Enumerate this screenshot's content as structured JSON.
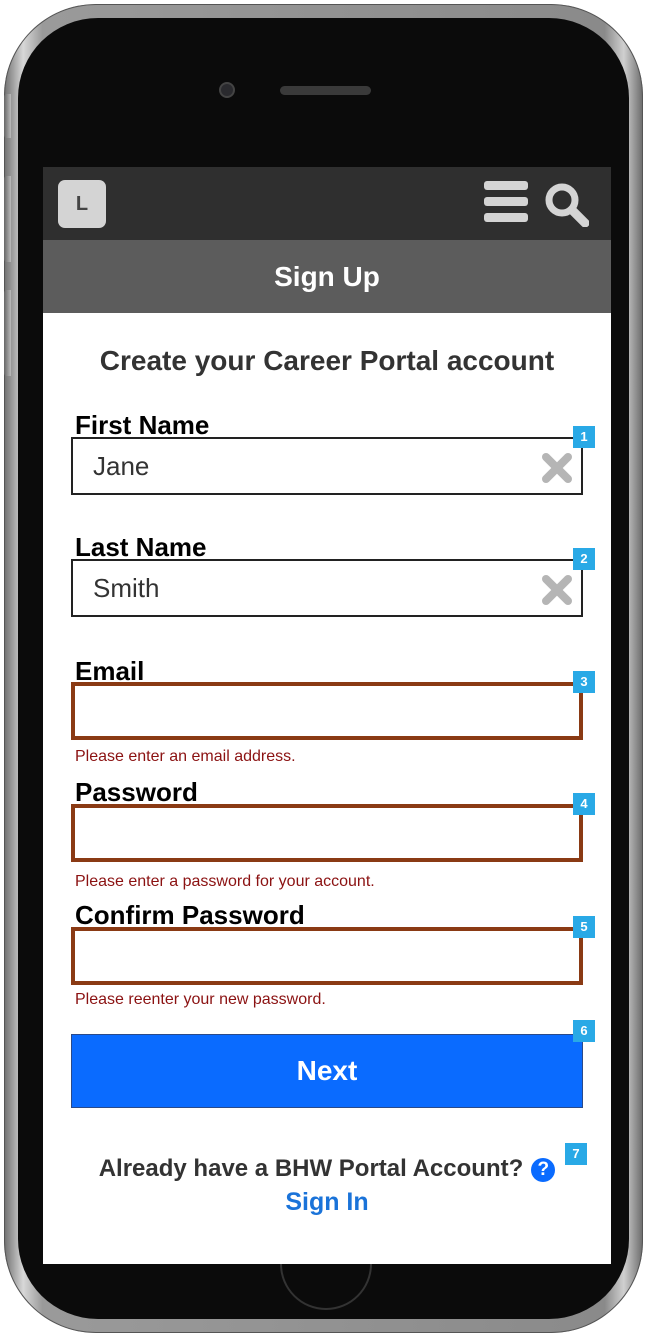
{
  "header": {
    "logo_letter": "L",
    "menu_icon": "hamburger-menu-icon",
    "search_icon": "magnifier-search-icon"
  },
  "title_bar": {
    "title": "Sign Up"
  },
  "form": {
    "heading": "Create your Career Portal account",
    "first_name": {
      "label": "First Name",
      "value": "Jane",
      "badge": "1"
    },
    "last_name": {
      "label": "Last Name",
      "value": "Smith",
      "badge": "2"
    },
    "email": {
      "label": "Email",
      "value": "",
      "error": "Please enter an email address.",
      "badge": "3"
    },
    "password": {
      "label": "Password",
      "value": "",
      "error": "Please enter a password for your account.",
      "badge": "4"
    },
    "confirm_password": {
      "label": "Confirm Password",
      "value": "",
      "error": "Please reenter your new password.",
      "badge": "5"
    },
    "next_button": {
      "label": "Next",
      "badge": "6"
    }
  },
  "footer": {
    "already_text": "Already have a BHW Portal Account?",
    "help_glyph": "?",
    "help_badge": "7",
    "sign_in_label": "Sign In"
  },
  "colors": {
    "accent_blue": "#0a6bff",
    "error_border": "#8a3a14",
    "error_text": "#8b1212",
    "badge_blue": "#29a9e6",
    "topbar": "#2f2f2f",
    "titlebar": "#5c5c5c"
  }
}
